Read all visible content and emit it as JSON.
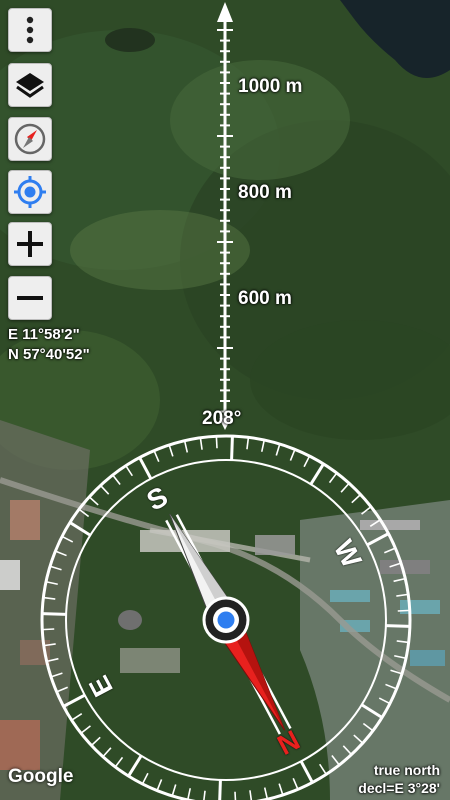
{
  "map": {
    "scale_labels": [
      "1000 m",
      "800 m",
      "600 m"
    ],
    "heading": "208°",
    "attribution": "Google"
  },
  "controls": {
    "menu_icon": "more-vertical-icon",
    "layers_icon": "layers-icon",
    "compass_icon": "compass-icon",
    "location_icon": "my-location-icon",
    "zoom_in_icon": "plus-icon",
    "zoom_out_icon": "minus-icon"
  },
  "coordinates": {
    "longitude": "E 11°58'2\"",
    "latitude": "N 57°40'52\""
  },
  "compass": {
    "letters": [
      "S",
      "W",
      "N",
      "E"
    ],
    "north_reference": "true north",
    "declination": "decl=E 3°28'"
  },
  "colors": {
    "needle_red": "#e8211e",
    "needle_white": "#f2f2f2",
    "location_blue": "#2f7ef0",
    "button_bg": "#eeeeee"
  }
}
